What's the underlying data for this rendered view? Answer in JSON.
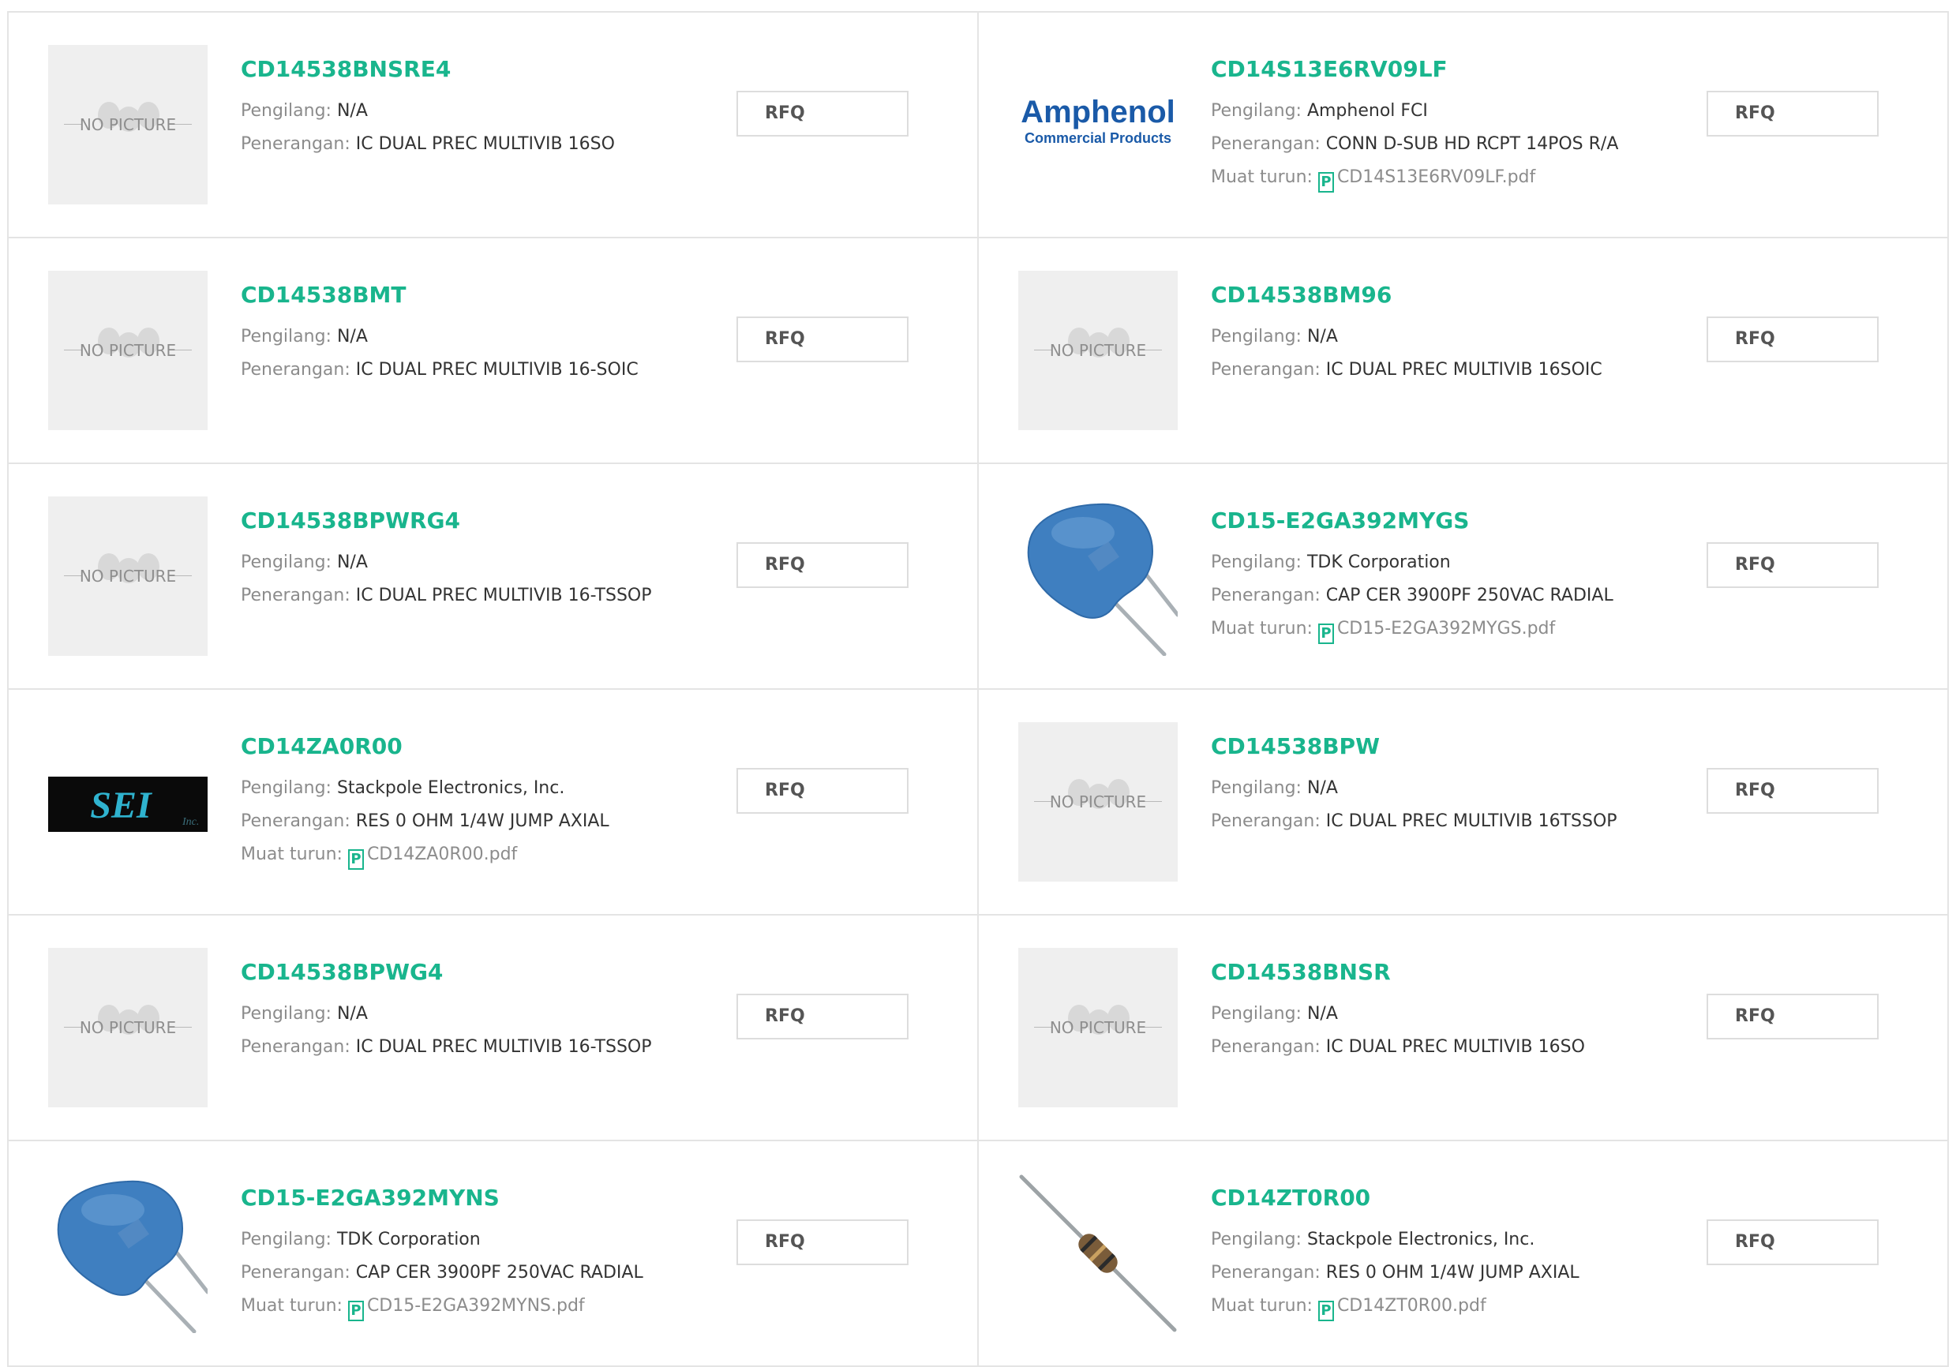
{
  "labels": {
    "manufacturer": "Pengilang: ",
    "description": "Penerangan: ",
    "download": "Muat turun: ",
    "rfq": "RFQ",
    "no_picture": "NO PICTURE",
    "pdf_glyph": "P"
  },
  "products": [
    {
      "part": "CD14538BNSRE4",
      "image": "no-picture",
      "manufacturer": "N/A",
      "description": "IC DUAL PREC MULTIVIB 16SO",
      "download": null
    },
    {
      "part": "CD14S13E6RV09LF",
      "image": "amphenol-logo",
      "logo_text": "Amphenol",
      "logo_subtext": "Commercial Products",
      "manufacturer": "Amphenol FCI",
      "description": "CONN D-SUB HD RCPT 14POS R/A",
      "download": "CD14S13E6RV09LF.pdf"
    },
    {
      "part": "CD14538BMT",
      "image": "no-picture",
      "manufacturer": "N/A",
      "description": "IC DUAL PREC MULTIVIB 16-SOIC",
      "download": null
    },
    {
      "part": "CD14538BM96",
      "image": "no-picture",
      "manufacturer": "N/A",
      "description": "IC DUAL PREC MULTIVIB 16SOIC",
      "download": null
    },
    {
      "part": "CD14538BPWRG4",
      "image": "no-picture",
      "manufacturer": "N/A",
      "description": "IC DUAL PREC MULTIVIB 16-TSSOP",
      "download": null
    },
    {
      "part": "CD15-E2GA392MYGS",
      "image": "capacitor-photo",
      "manufacturer": "TDK Corporation",
      "description": "CAP CER 3900PF 250VAC RADIAL",
      "download": "CD15-E2GA392MYGS.pdf"
    },
    {
      "part": "CD14ZA0R00",
      "image": "sei-logo",
      "logo_text": "SEI",
      "logo_subtext": "Inc.",
      "manufacturer": "Stackpole Electronics, Inc.",
      "description": "RES 0 OHM 1/4W JUMP AXIAL",
      "download": "CD14ZA0R00.pdf"
    },
    {
      "part": "CD14538BPW",
      "image": "no-picture",
      "manufacturer": "N/A",
      "description": "IC DUAL PREC MULTIVIB 16TSSOP",
      "download": null
    },
    {
      "part": "CD14538BPWG4",
      "image": "no-picture",
      "manufacturer": "N/A",
      "description": "IC DUAL PREC MULTIVIB 16-TSSOP",
      "download": null
    },
    {
      "part": "CD14538BNSR",
      "image": "no-picture",
      "manufacturer": "N/A",
      "description": "IC DUAL PREC MULTIVIB 16SO",
      "download": null
    },
    {
      "part": "CD15-E2GA392MYNS",
      "image": "capacitor-photo",
      "manufacturer": "TDK Corporation",
      "description": "CAP CER 3900PF 250VAC RADIAL",
      "download": "CD15-E2GA392MYNS.pdf"
    },
    {
      "part": "CD14ZT0R00",
      "image": "resistor-photo",
      "manufacturer": "Stackpole Electronics, Inc.",
      "description": "RES 0 OHM 1/4W JUMP AXIAL",
      "download": "CD14ZT0R00.pdf"
    }
  ],
  "colors": {
    "part_link": "#19b58d",
    "label": "#8c8c8c",
    "value": "#333333",
    "border": "#e4e4e4",
    "capacitor_blue": "#3f7fc0",
    "amphenol_blue": "#1a5aa8"
  }
}
